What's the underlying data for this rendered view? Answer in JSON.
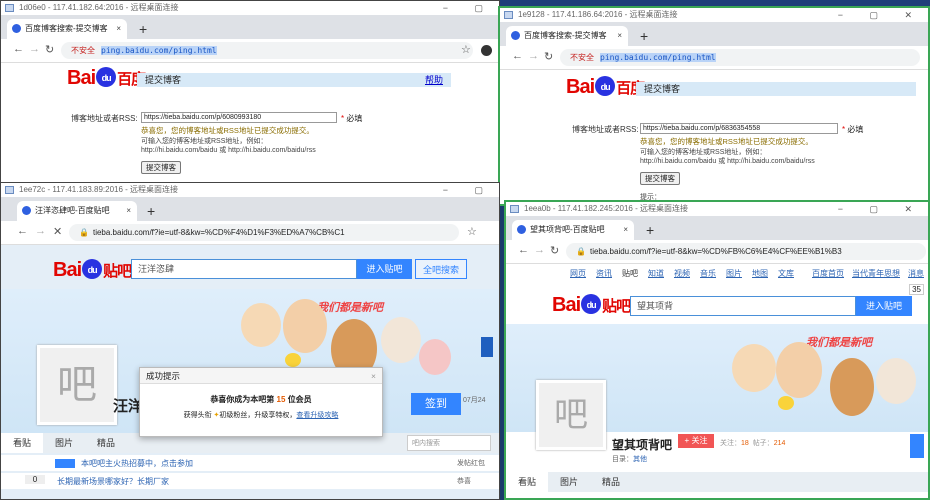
{
  "windows": [
    {
      "id": "w1",
      "titlebar": "1d06e0 - 117.41.182.64:2016 - 远程桌面连接",
      "tab": "百度博客搜索-提交博客",
      "url_insecure": "不安全",
      "url": "ping.baidu.com/ping.html",
      "logo_text_left": "Bai",
      "logo_paw": "du",
      "logo_text_right": "百度",
      "bar_title": "提交博客",
      "help": "帮助",
      "label": "博客地址或者RSS:",
      "input": "https://tieba.baidu.com/p/6080993180",
      "required": "必填",
      "success": "恭喜您，您的博客地址或RSS地址已提交成功提交。",
      "hint1": "可输入您的博客地址或RSS地址，例如：",
      "hint2": "http://hi.baidu.com/baidu 或 http://hi.baidu.com/baidu/rss",
      "submit": "提交博客"
    },
    {
      "id": "w2",
      "titlebar": "1e9128 - 117.41.186.64:2016 - 远程桌面连接",
      "tab": "百度博客搜索-提交博客",
      "url_insecure": "不安全",
      "url": "ping.baidu.com/ping.html",
      "logo_text_left": "Bai",
      "logo_paw": "du",
      "logo_text_right": "百度",
      "bar_title": "提交博客",
      "label": "博客地址或者RSS:",
      "input": "https://tieba.baidu.com/p/6836354558",
      "required": "必填",
      "success": "恭喜您，您的博客地址或RSS地址已提交成功提交。",
      "hint1": "可输入您的博客地址或RSS地址，例如：",
      "hint2": "http://hi.baidu.com/baidu 或 http://hi.baidu.com/baidu/rss",
      "submit": "提交博客",
      "tip": "提示："
    },
    {
      "id": "w3",
      "titlebar": "1ee72c - 117.41.183.89:2016 - 远程桌面连接",
      "tab": "汪洋恣肆吧-百度贴吧",
      "url": "tieba.baidu.com/f?ie=utf-8&kw=%CD%F4%D1%F3%ED%A7%CB%C1",
      "logo_text_left": "Bai",
      "logo_paw": "du",
      "logo_text_right": "贴吧",
      "search": "汪洋恣肆",
      "enter_btn": "进入贴吧",
      "all_search": "全吧搜索",
      "slogan": "我们都是新吧",
      "forum_name": "汪洋",
      "avatar_char": "吧",
      "sign_btn": "签到",
      "date_frag": "07月24",
      "tab_posts": "看贴",
      "tab_pics": "图片",
      "tab_best": "精品",
      "search_in": "吧内搜索",
      "row1": "本吧吧主火热招募中，点击参加",
      "row2_count": "0",
      "row2": "长期最新场景哪家好？长期厂家",
      "side1": "发帖红包",
      "side2": "恭喜"
    },
    {
      "id": "w4",
      "titlebar": "1eea0b - 117.41.182.245:2016 - 远程桌面连接",
      "tab": "望其项背吧-百度贴吧",
      "url": "tieba.baidu.com/f?ie=utf-8&kw=%CD%FB%C6%E4%CF%EE%B1%B3",
      "nav": [
        "网页",
        "资讯",
        "贴吧",
        "知道",
        "视频",
        "音乐",
        "图片",
        "地图",
        "文库"
      ],
      "nav_right": [
        "百度首页",
        "当代青年思想",
        "消息"
      ],
      "logo_text_left": "Bai",
      "logo_paw": "du",
      "logo_text_right": "贴吧",
      "search": "望其项背",
      "enter_btn": "进入贴吧",
      "slogan": "我们都是新吧",
      "avatar_char": "吧",
      "forum_name": "望其项背吧",
      "follow_btn": "+ 关注",
      "follow_label": "关注：",
      "follow_count": "18",
      "posts_label": "帖子：",
      "posts_count": "214",
      "dir_label": "目录：",
      "dir_value": "其他",
      "tab_posts": "看贴",
      "tab_pics": "图片",
      "tab_best": "精品",
      "side_num": "35"
    }
  ],
  "dialog": {
    "title": "成功提示",
    "line1_pre": "恭喜你成为本吧第",
    "line1_num": "15",
    "line1_post": "位会员",
    "line2_pre": "获得头衔",
    "line2_badge": "初级粉丝，升级享特权，",
    "line2_link": "查看升级攻略"
  }
}
